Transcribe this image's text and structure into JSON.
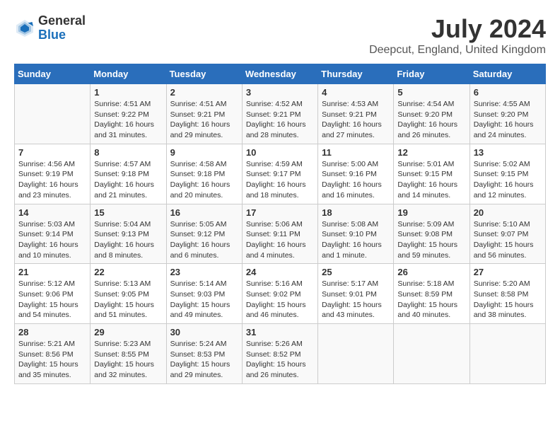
{
  "header": {
    "logo_general": "General",
    "logo_blue": "Blue",
    "month_year": "July 2024",
    "location": "Deepcut, England, United Kingdom"
  },
  "calendar": {
    "days_of_week": [
      "Sunday",
      "Monday",
      "Tuesday",
      "Wednesday",
      "Thursday",
      "Friday",
      "Saturday"
    ],
    "weeks": [
      [
        {
          "day": "",
          "info": ""
        },
        {
          "day": "1",
          "info": "Sunrise: 4:51 AM\nSunset: 9:22 PM\nDaylight: 16 hours\nand 31 minutes."
        },
        {
          "day": "2",
          "info": "Sunrise: 4:51 AM\nSunset: 9:21 PM\nDaylight: 16 hours\nand 29 minutes."
        },
        {
          "day": "3",
          "info": "Sunrise: 4:52 AM\nSunset: 9:21 PM\nDaylight: 16 hours\nand 28 minutes."
        },
        {
          "day": "4",
          "info": "Sunrise: 4:53 AM\nSunset: 9:21 PM\nDaylight: 16 hours\nand 27 minutes."
        },
        {
          "day": "5",
          "info": "Sunrise: 4:54 AM\nSunset: 9:20 PM\nDaylight: 16 hours\nand 26 minutes."
        },
        {
          "day": "6",
          "info": "Sunrise: 4:55 AM\nSunset: 9:20 PM\nDaylight: 16 hours\nand 24 minutes."
        }
      ],
      [
        {
          "day": "7",
          "info": "Sunrise: 4:56 AM\nSunset: 9:19 PM\nDaylight: 16 hours\nand 23 minutes."
        },
        {
          "day": "8",
          "info": "Sunrise: 4:57 AM\nSunset: 9:18 PM\nDaylight: 16 hours\nand 21 minutes."
        },
        {
          "day": "9",
          "info": "Sunrise: 4:58 AM\nSunset: 9:18 PM\nDaylight: 16 hours\nand 20 minutes."
        },
        {
          "day": "10",
          "info": "Sunrise: 4:59 AM\nSunset: 9:17 PM\nDaylight: 16 hours\nand 18 minutes."
        },
        {
          "day": "11",
          "info": "Sunrise: 5:00 AM\nSunset: 9:16 PM\nDaylight: 16 hours\nand 16 minutes."
        },
        {
          "day": "12",
          "info": "Sunrise: 5:01 AM\nSunset: 9:15 PM\nDaylight: 16 hours\nand 14 minutes."
        },
        {
          "day": "13",
          "info": "Sunrise: 5:02 AM\nSunset: 9:15 PM\nDaylight: 16 hours\nand 12 minutes."
        }
      ],
      [
        {
          "day": "14",
          "info": "Sunrise: 5:03 AM\nSunset: 9:14 PM\nDaylight: 16 hours\nand 10 minutes."
        },
        {
          "day": "15",
          "info": "Sunrise: 5:04 AM\nSunset: 9:13 PM\nDaylight: 16 hours\nand 8 minutes."
        },
        {
          "day": "16",
          "info": "Sunrise: 5:05 AM\nSunset: 9:12 PM\nDaylight: 16 hours\nand 6 minutes."
        },
        {
          "day": "17",
          "info": "Sunrise: 5:06 AM\nSunset: 9:11 PM\nDaylight: 16 hours\nand 4 minutes."
        },
        {
          "day": "18",
          "info": "Sunrise: 5:08 AM\nSunset: 9:10 PM\nDaylight: 16 hours\nand 1 minute."
        },
        {
          "day": "19",
          "info": "Sunrise: 5:09 AM\nSunset: 9:08 PM\nDaylight: 15 hours\nand 59 minutes."
        },
        {
          "day": "20",
          "info": "Sunrise: 5:10 AM\nSunset: 9:07 PM\nDaylight: 15 hours\nand 56 minutes."
        }
      ],
      [
        {
          "day": "21",
          "info": "Sunrise: 5:12 AM\nSunset: 9:06 PM\nDaylight: 15 hours\nand 54 minutes."
        },
        {
          "day": "22",
          "info": "Sunrise: 5:13 AM\nSunset: 9:05 PM\nDaylight: 15 hours\nand 51 minutes."
        },
        {
          "day": "23",
          "info": "Sunrise: 5:14 AM\nSunset: 9:03 PM\nDaylight: 15 hours\nand 49 minutes."
        },
        {
          "day": "24",
          "info": "Sunrise: 5:16 AM\nSunset: 9:02 PM\nDaylight: 15 hours\nand 46 minutes."
        },
        {
          "day": "25",
          "info": "Sunrise: 5:17 AM\nSunset: 9:01 PM\nDaylight: 15 hours\nand 43 minutes."
        },
        {
          "day": "26",
          "info": "Sunrise: 5:18 AM\nSunset: 8:59 PM\nDaylight: 15 hours\nand 40 minutes."
        },
        {
          "day": "27",
          "info": "Sunrise: 5:20 AM\nSunset: 8:58 PM\nDaylight: 15 hours\nand 38 minutes."
        }
      ],
      [
        {
          "day": "28",
          "info": "Sunrise: 5:21 AM\nSunset: 8:56 PM\nDaylight: 15 hours\nand 35 minutes."
        },
        {
          "day": "29",
          "info": "Sunrise: 5:23 AM\nSunset: 8:55 PM\nDaylight: 15 hours\nand 32 minutes."
        },
        {
          "day": "30",
          "info": "Sunrise: 5:24 AM\nSunset: 8:53 PM\nDaylight: 15 hours\nand 29 minutes."
        },
        {
          "day": "31",
          "info": "Sunrise: 5:26 AM\nSunset: 8:52 PM\nDaylight: 15 hours\nand 26 minutes."
        },
        {
          "day": "",
          "info": ""
        },
        {
          "day": "",
          "info": ""
        },
        {
          "day": "",
          "info": ""
        }
      ]
    ]
  }
}
